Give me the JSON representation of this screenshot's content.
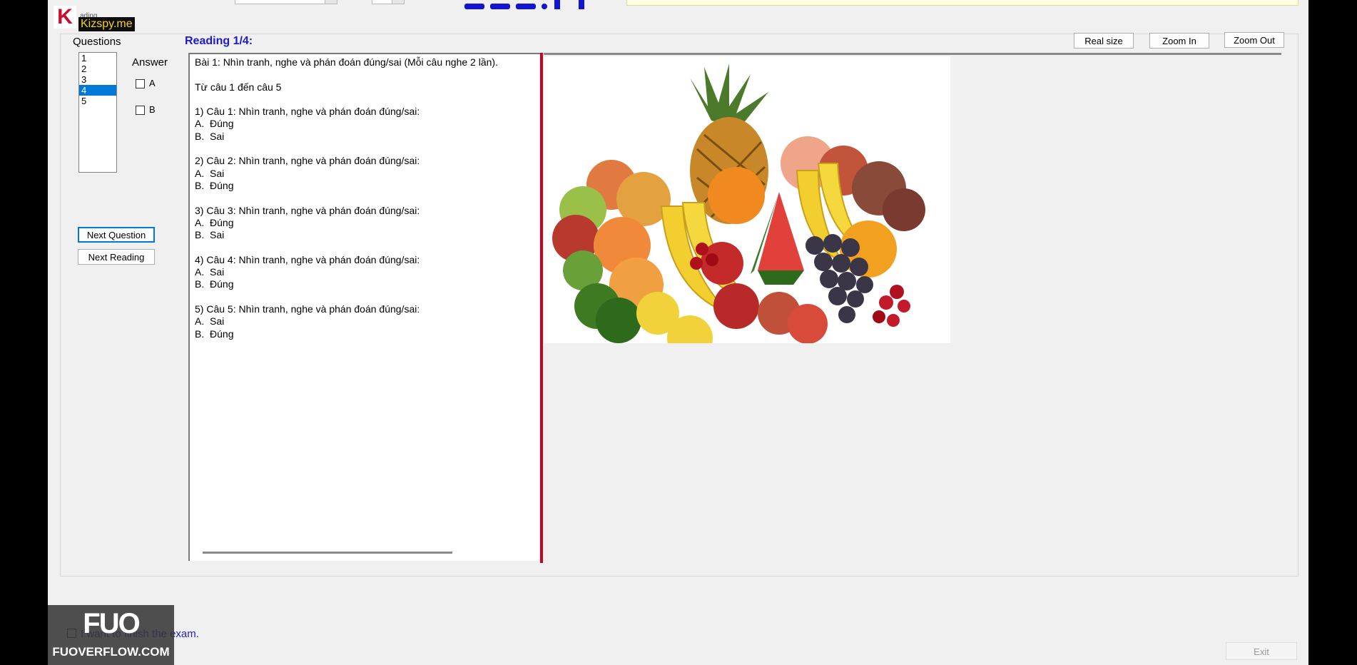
{
  "logo": {
    "mark": "K",
    "text": "Kizspy.me",
    "under": "ading"
  },
  "labels": {
    "questions": "Questions",
    "reading": "Reading 1/4:",
    "answer": "Answer"
  },
  "question_list": [
    "1",
    "2",
    "3",
    "4",
    "5"
  ],
  "selected_question": "4",
  "answers": [
    {
      "label": "A",
      "checked": false
    },
    {
      "label": "B",
      "checked": false
    }
  ],
  "buttons": {
    "next_question": "Next Question",
    "next_reading": "Next Reading",
    "real_size": "Real size",
    "zoom_in": "Zoom In",
    "zoom_out": "Zoom Out",
    "exit": "Exit"
  },
  "reading_text": "Bài 1: Nhìn tranh, nghe và phán đoán đúng/sai (Mỗi câu nghe 2 lần).\n\nTừ câu 1 đến câu 5\n\n1) Câu 1: Nhìn tranh, nghe và phán đoán đúng/sai:\nA.  Đúng\nB.  Sai\n\n2) Câu 2: Nhìn tranh, nghe và phán đoán đúng/sai:\nA.  Sai\nB.  Đúng\n\n3) Câu 3: Nhìn tranh, nghe và phán đoán đúng/sai:\nA.  Đúng\nB.  Sai\n\n4) Câu 4: Nhìn tranh, nghe và phán đoán đúng/sai:\nA.  Sai\nB.  Đúng\n\n5) Câu 5: Nhìn tranh, nghe và phán đoán đúng/sai:\nA.  Sai\nB.  Đúng",
  "finish": {
    "label": "I want to finish the exam."
  },
  "watermark": {
    "big": "FUO",
    "small": "FUOVERFLOW.COM"
  },
  "image": {
    "subject": "fruit-still-life-image"
  },
  "colors": {
    "selection": "#0078d7",
    "reading_title": "#1a1ad6",
    "splitter": "#d0021b",
    "timer": "#1313d6"
  }
}
